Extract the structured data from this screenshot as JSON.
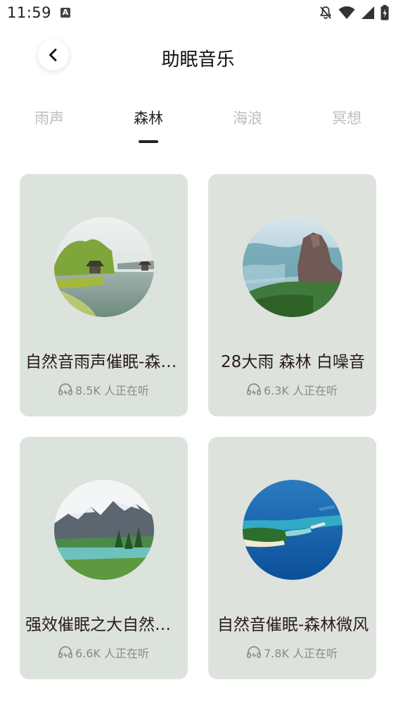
{
  "status_bar": {
    "time": "11:59",
    "app_icon_letter": "A",
    "icons": [
      "a-notification-icon",
      "bell-off-icon",
      "wifi-icon",
      "cell-signal-icon",
      "battery-icon"
    ]
  },
  "header": {
    "title": "助眠音乐",
    "back_icon": "chevron-left-icon"
  },
  "tabs": [
    {
      "label": "雨声",
      "active": false
    },
    {
      "label": "森林",
      "active": true
    },
    {
      "label": "海浪",
      "active": false
    },
    {
      "label": "冥想",
      "active": false
    }
  ],
  "cards": [
    {
      "title": "自然音雨声催眠-森林雨声",
      "listeners": "8.5K 人正在听",
      "bg": "#dbe3dc",
      "image": "lake-pavilion-scene"
    },
    {
      "title": "28大雨 森林 白噪音",
      "listeners": "6.3K 人正在听",
      "bg": "#dde2dd",
      "image": "misty-cliff-forest"
    },
    {
      "title": "强效催眠之大自然森林",
      "listeners": "6.6K 人正在听",
      "bg": "#dbe3dc",
      "image": "mountain-lake"
    },
    {
      "title": "自然音催眠-森林微风",
      "listeners": "7.8K 人正在听",
      "bg": "#dde2dd",
      "image": "tropical-island"
    }
  ],
  "colors": {
    "active_tab": "#222222",
    "inactive_tab": "#bdbdbd",
    "listener_text": "#8a8a8a"
  }
}
